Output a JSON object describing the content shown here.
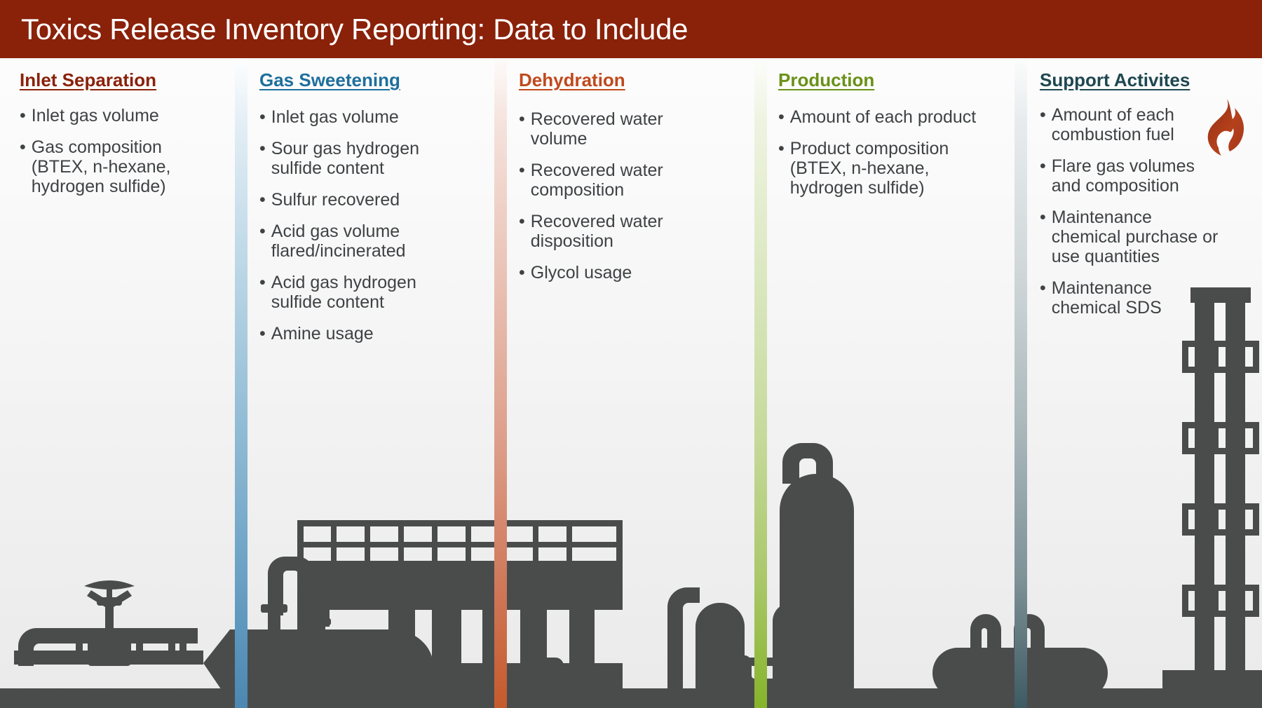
{
  "header": {
    "title": "Toxics Release Inventory Reporting: Data to Include",
    "bg_color": "#8a2109",
    "text_color": "#ffffff"
  },
  "columns": [
    {
      "id": "inlet-separation",
      "heading": "Inlet Separation",
      "accent_color": "#8a2109",
      "bullets": [
        "Inlet gas volume",
        "Gas composition (BTEX, n-hexane, hydrogen sulfide)"
      ]
    },
    {
      "id": "gas-sweetening",
      "heading": "Gas Sweetening",
      "accent_color": "#1e6f9c",
      "bullets": [
        "Inlet gas volume",
        "Sour gas hydrogen sulfide content",
        "Sulfur recovered",
        "Acid gas volume flared/incinerated",
        "Acid gas hydrogen sulfide content",
        "Amine usage"
      ]
    },
    {
      "id": "dehydration",
      "heading": "Dehydration",
      "accent_color": "#c0491d",
      "bullets": [
        "Recovered water volume",
        "Recovered water composition",
        "Recovered water disposition",
        "Glycol usage"
      ]
    },
    {
      "id": "production",
      "heading": "Production",
      "accent_color": "#6a9118",
      "bullets": [
        "Amount of each product",
        "Product composition (BTEX, n-hexane, hydrogen sulfide)"
      ]
    },
    {
      "id": "support-activites",
      "heading": "Support Activites",
      "accent_color": "#1e4750",
      "bullets": [
        "Amount of each combustion fuel",
        "Flare gas volumes and composition",
        "Maintenance chemical purchase or use quantities",
        "Maintenance chemical SDS"
      ]
    }
  ],
  "bullet_marker": "•",
  "dividers": [
    {
      "name": "divider-blue",
      "from": "#fdfefe",
      "to": "#4b87b2"
    },
    {
      "name": "divider-orange",
      "from": "#fdfbfa",
      "to": "#c55a2c"
    },
    {
      "name": "divider-green",
      "from": "#fcfdfa",
      "to": "#86b42a"
    },
    {
      "name": "divider-teal",
      "from": "#fbfcfc",
      "to": "#3d5a62"
    }
  ],
  "graphics": {
    "flame_icon": "flame-icon",
    "flame_colors": {
      "outer": "#b4401c",
      "inner": "#8f2f13"
    },
    "refinery_silhouette": "refinery-silhouette",
    "silhouette_color": "#4a4c4c"
  }
}
